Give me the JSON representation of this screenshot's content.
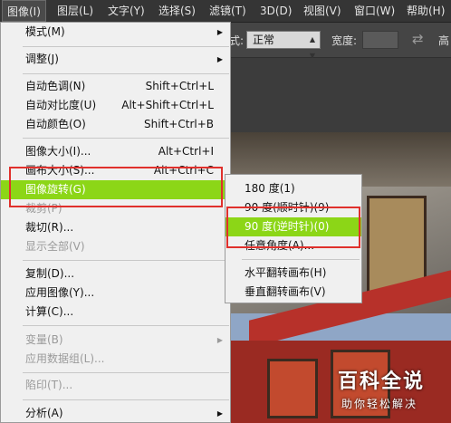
{
  "menubar": {
    "items": [
      {
        "label": "图像(I)"
      },
      {
        "label": "图层(L)"
      },
      {
        "label": "文字(Y)"
      },
      {
        "label": "选择(S)"
      },
      {
        "label": "滤镜(T)"
      },
      {
        "label": "3D(D)"
      },
      {
        "label": "视图(V)"
      },
      {
        "label": "窗口(W)"
      },
      {
        "label": "帮助(H)"
      }
    ]
  },
  "options": {
    "style_label": "式:",
    "style_value": "正常",
    "width_label": "宽度:",
    "height_label": "高"
  },
  "image_menu": {
    "items": [
      {
        "label": "模式(M)",
        "submenu": true
      },
      {
        "label": "调整(J)",
        "submenu": true
      },
      {
        "label": "自动色调(N)",
        "shortcut": "Shift+Ctrl+L"
      },
      {
        "label": "自动对比度(U)",
        "shortcut": "Alt+Shift+Ctrl+L"
      },
      {
        "label": "自动颜色(O)",
        "shortcut": "Shift+Ctrl+B"
      },
      {
        "label": "图像大小(I)...",
        "shortcut": "Alt+Ctrl+I"
      },
      {
        "label": "画布大小(S)...",
        "shortcut": "Alt+Ctrl+C"
      },
      {
        "label": "图像旋转(G)",
        "submenu": true,
        "highlighted": true
      },
      {
        "label": "裁剪(P)",
        "disabled": true
      },
      {
        "label": "裁切(R)..."
      },
      {
        "label": "显示全部(V)",
        "disabled": true
      },
      {
        "label": "复制(D)..."
      },
      {
        "label": "应用图像(Y)..."
      },
      {
        "label": "计算(C)..."
      },
      {
        "label": "变量(B)",
        "disabled": true,
        "submenu": true
      },
      {
        "label": "应用数据组(L)...",
        "disabled": true
      },
      {
        "label": "陷印(T)...",
        "disabled": true
      },
      {
        "label": "分析(A)",
        "submenu": true
      }
    ]
  },
  "rotate_submenu": {
    "items": [
      {
        "label": "180 度(1)"
      },
      {
        "label": "90 度(顺时针)(9)"
      },
      {
        "label": "90 度(逆时针)(0)",
        "highlighted": true
      },
      {
        "label": "任意角度(A)..."
      },
      {
        "label": "水平翻转画布(H)"
      },
      {
        "label": "垂直翻转画布(V)"
      }
    ]
  },
  "watermark": {
    "title": "百科全说",
    "subtitle": "助你轻松解决"
  },
  "colors": {
    "highlight": "#8cd617",
    "annotation": "#e0302c"
  }
}
